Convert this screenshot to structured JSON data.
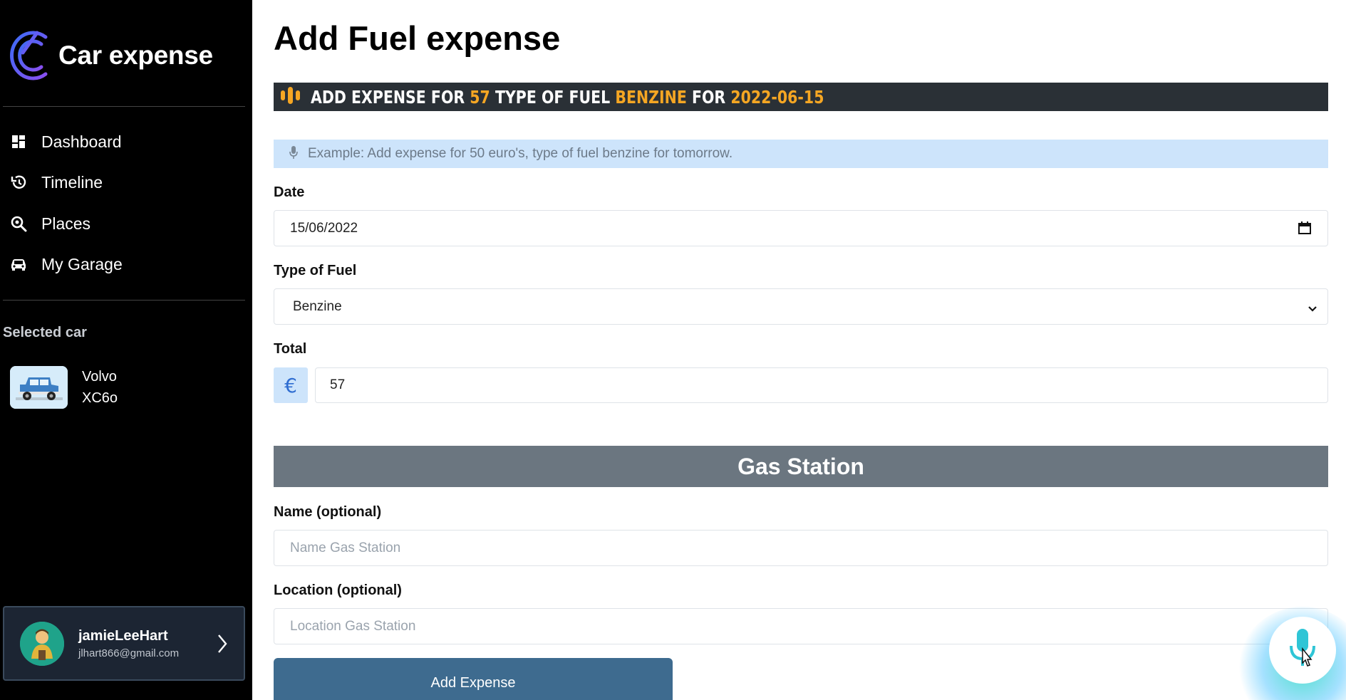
{
  "brand": {
    "name": "Car expense",
    "logo_icon": "c-logo-icon"
  },
  "nav": [
    {
      "label": "Dashboard",
      "icon": "dashboard-icon"
    },
    {
      "label": "Timeline",
      "icon": "history-icon"
    },
    {
      "label": "Places",
      "icon": "search-location-icon"
    },
    {
      "label": "My Garage",
      "icon": "car-icon"
    }
  ],
  "selected_car": {
    "title": "Selected car",
    "make": "Volvo",
    "model": "XC6o"
  },
  "user": {
    "name": "jamieLeeHart",
    "email": "jlhart866@gmail.com"
  },
  "page": {
    "title": "Add Fuel expense"
  },
  "voice_command": {
    "p1": "ADD EXPENSE FOR ",
    "amount": "57",
    "p2": " TYPE OF FUEL ",
    "fuel": "BENZINE",
    "p3": " FOR ",
    "date": "2022-06-15"
  },
  "hint": {
    "text": "Example: Add expense for 50 euro's, type of fuel benzine for tomorrow."
  },
  "form": {
    "date_label": "Date",
    "date_value": "15/06/2022",
    "fuel_label": "Type of Fuel",
    "fuel_value": "Benzine",
    "total_label": "Total",
    "currency_symbol": "€",
    "total_value": "57",
    "gas_station_header": "Gas Station",
    "name_label": "Name (optional)",
    "name_placeholder": "Name Gas Station",
    "location_label": "Location (optional)",
    "location_placeholder": "Location Gas Station",
    "submit_label": "Add Expense"
  },
  "colors": {
    "accent": "#f5a623",
    "button": "#3e6b8f",
    "header_gray": "#6b7680",
    "hint_bg": "#cde4fb"
  }
}
